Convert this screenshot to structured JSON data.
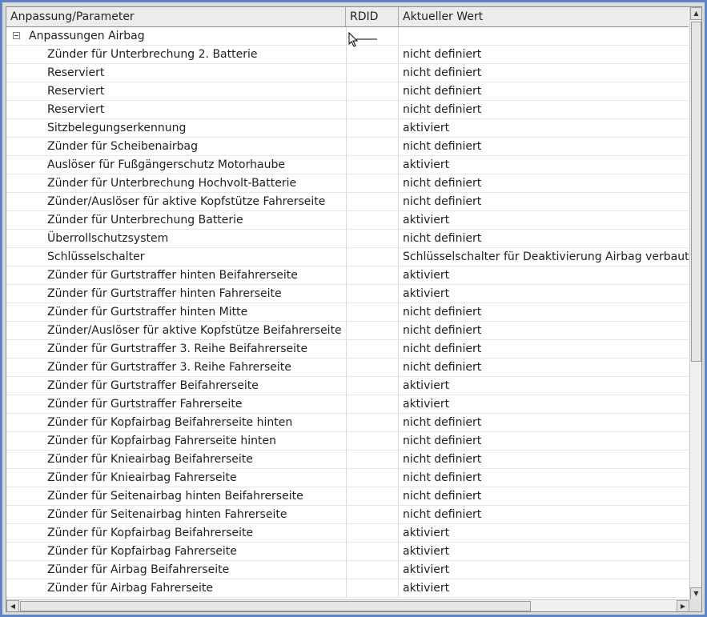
{
  "columns": {
    "param": "Anpassung/Parameter",
    "rdid": "RDID",
    "value": "Aktueller Wert"
  },
  "group": {
    "label": "Anpassungen Airbag",
    "expander_symbol": "minus"
  },
  "rows": [
    {
      "param": "Zünder für Unterbrechung 2. Batterie",
      "rdid": "",
      "value": "nicht definiert"
    },
    {
      "param": "Reserviert",
      "rdid": "",
      "value": "nicht definiert"
    },
    {
      "param": "Reserviert",
      "rdid": "",
      "value": "nicht definiert"
    },
    {
      "param": "Reserviert",
      "rdid": "",
      "value": "nicht definiert"
    },
    {
      "param": "Sitzbelegungserkennung",
      "rdid": "",
      "value": "aktiviert"
    },
    {
      "param": "Zünder für Scheibenairbag",
      "rdid": "",
      "value": "nicht definiert"
    },
    {
      "param": "Auslöser für Fußgängerschutz Motorhaube",
      "rdid": "",
      "value": "aktiviert"
    },
    {
      "param": "Zünder für Unterbrechung Hochvolt-Batterie",
      "rdid": "",
      "value": "nicht definiert"
    },
    {
      "param": "Zünder/Auslöser für aktive Kopfstütze Fahrerseite",
      "rdid": "",
      "value": "nicht definiert"
    },
    {
      "param": "Zünder für Unterbrechung Batterie",
      "rdid": "",
      "value": "aktiviert"
    },
    {
      "param": "Überrollschutzsystem",
      "rdid": "",
      "value": "nicht definiert"
    },
    {
      "param": "Schlüsselschalter",
      "rdid": "",
      "value": "Schlüsselschalter für Deaktivierung Airbag verbaut"
    },
    {
      "param": "Zünder für Gurtstraffer hinten Beifahrerseite",
      "rdid": "",
      "value": "aktiviert"
    },
    {
      "param": "Zünder für Gurtstraffer hinten Fahrerseite",
      "rdid": "",
      "value": "aktiviert"
    },
    {
      "param": "Zünder für Gurtstraffer hinten Mitte",
      "rdid": "",
      "value": "nicht definiert"
    },
    {
      "param": "Zünder/Auslöser für aktive Kopfstütze Beifahrerseite",
      "rdid": "",
      "value": "nicht definiert"
    },
    {
      "param": "Zünder für Gurtstraffer 3. Reihe Beifahrerseite",
      "rdid": "",
      "value": "nicht definiert"
    },
    {
      "param": "Zünder für Gurtstraffer 3. Reihe Fahrerseite",
      "rdid": "",
      "value": "nicht definiert"
    },
    {
      "param": "Zünder für Gurtstraffer Beifahrerseite",
      "rdid": "",
      "value": "aktiviert"
    },
    {
      "param": "Zünder für Gurtstraffer Fahrerseite",
      "rdid": "",
      "value": "aktiviert"
    },
    {
      "param": "Zünder für Kopfairbag Beifahrerseite hinten",
      "rdid": "",
      "value": "nicht definiert"
    },
    {
      "param": "Zünder für Kopfairbag Fahrerseite hinten",
      "rdid": "",
      "value": "nicht definiert"
    },
    {
      "param": "Zünder für Knieairbag Beifahrerseite",
      "rdid": "",
      "value": "nicht definiert"
    },
    {
      "param": "Zünder für Knieairbag Fahrerseite",
      "rdid": "",
      "value": "nicht definiert"
    },
    {
      "param": "Zünder für Seitenairbag hinten Beifahrerseite",
      "rdid": "",
      "value": "nicht definiert"
    },
    {
      "param": "Zünder für Seitenairbag hinten Fahrerseite",
      "rdid": "",
      "value": "nicht definiert"
    },
    {
      "param": "Zünder für Kopfairbag Beifahrerseite",
      "rdid": "",
      "value": "aktiviert"
    },
    {
      "param": "Zünder für Kopfairbag Fahrerseite",
      "rdid": "",
      "value": "aktiviert"
    },
    {
      "param": "Zünder für Airbag Beifahrerseite",
      "rdid": "",
      "value": "aktiviert"
    },
    {
      "param": "Zünder für Airbag Fahrerseite",
      "rdid": "",
      "value": "aktiviert"
    }
  ],
  "icons": {
    "scroll_up": "arrow-up-icon",
    "scroll_down": "arrow-down-icon",
    "scroll_left": "arrow-left-icon",
    "scroll_right": "arrow-right-icon",
    "cursor": "mouse-pointer-icon"
  },
  "colors": {
    "frame": "#5f84c3",
    "header_bg": "#ececec"
  }
}
